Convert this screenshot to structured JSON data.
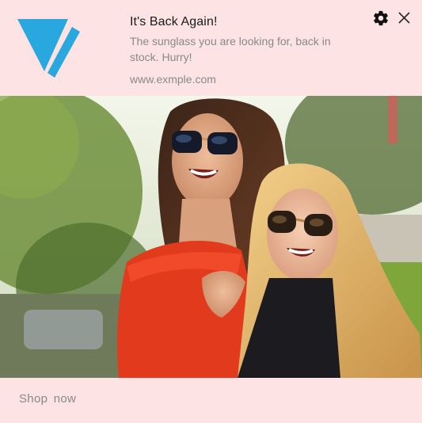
{
  "notification": {
    "title": "It's Back Again!",
    "message": "The sunglass you are looking for, back in stock. Hurry!",
    "site": "www.exmple.com",
    "action_label": "Shop  now",
    "brand_color": "#29a8e0",
    "background_color": "#fde3e3",
    "icons": {
      "settings": "gear-icon",
      "close": "close-icon",
      "logo": "brand-logo-v"
    }
  },
  "image": {
    "subject": "two smiling women wearing sunglasses outdoors"
  }
}
